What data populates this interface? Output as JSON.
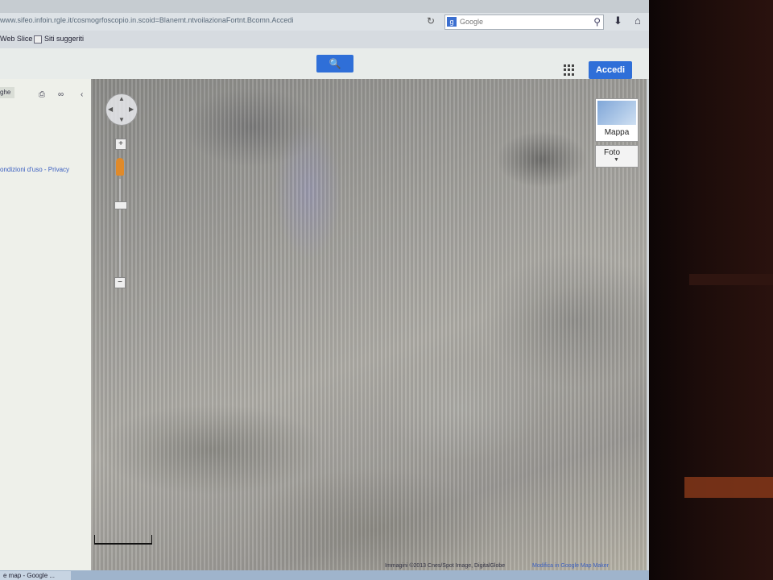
{
  "browser": {
    "url": "www.sifeo.infoin.rgle.it/cosmogrfoscopio.in.scoid=Blanemt.ntvoilazionaFortnt.Bcomn.Accedi",
    "search_placeholder": "Google"
  },
  "bookmarks": [
    {
      "label": "Web Slice"
    },
    {
      "label": "Siti suggeriti"
    }
  ],
  "header": {
    "search_button_glyph": "🔍",
    "signin_label": "Accedi"
  },
  "left_panel": {
    "tab_label": "ghe",
    "terms_link": "ondizioni d'uso - Privacy"
  },
  "map": {
    "map_type_label": "Mappa",
    "photo_label": "Foto",
    "attribution": "Immagini ©2013 Cnes/Spot Image, DigitalGlobe",
    "report_link": "Modifica in Google Map Maker"
  },
  "taskbar": {
    "active_tab": "e map - Google ..."
  },
  "colors": {
    "accent_blue": "#2f6fd8",
    "pegman_orange": "#e08a2a"
  }
}
